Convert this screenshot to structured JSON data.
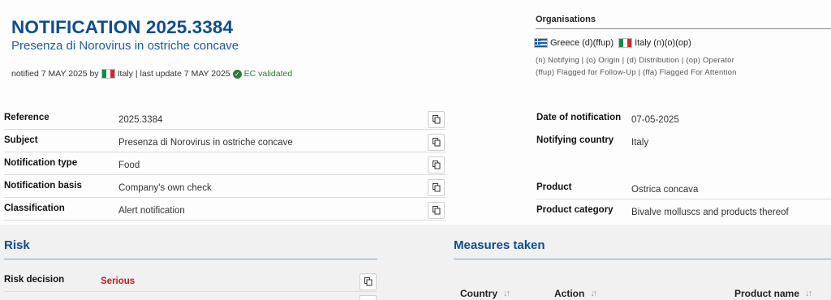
{
  "header": {
    "title": "NOTIFICATION 2025.3384",
    "subtitle": "Presenza di Norovirus in ostriche concave",
    "notified_prefix": "notified 7 MAY 2025 by",
    "notified_country": "Italy",
    "last_update": "| last update 7 MAY 2025",
    "ec_status": "EC validated"
  },
  "organisations": {
    "title": "Organisations",
    "countries": [
      {
        "name": "Greece (d)(ffup)",
        "flag": "greece-flag"
      },
      {
        "name": "Italy (n)(o)(op)",
        "flag": "italy-flag"
      }
    ],
    "legend_line1": "(n) Notifying | (o) Origin | (d) Distribution | (op) Operator",
    "legend_line2": "(ffup) Flagged for Follow-Up | (ffa) Flagged For Attention"
  },
  "details_left": [
    {
      "label": "Reference",
      "value": "2025.3384"
    },
    {
      "label": "Subject",
      "value": "Presenza di Norovirus in ostriche concave"
    },
    {
      "label": "Notification type",
      "value": "Food"
    },
    {
      "label": "Notification basis",
      "value": "Company's own check"
    },
    {
      "label": "Classification",
      "value": "Alert notification"
    }
  ],
  "details_right": {
    "date_label": "Date of notification",
    "date_value": "07-05-2025",
    "country_label": "Notifying country",
    "country_value": "Italy",
    "product_label": "Product",
    "product_value": "Ostrica concava",
    "category_label": "Product category",
    "category_value": "Bivalve molluscs and products thereof"
  },
  "risk": {
    "title": "Risk",
    "decision_label": "Risk decision",
    "decision_value": "Serious"
  },
  "measures": {
    "title": "Measures taken",
    "columns": [
      "Country",
      "Action",
      "Product name"
    ]
  },
  "colors": {
    "title_blue": "#0e4c92",
    "serious_red": "#c61d1d",
    "validated_green": "#2d7a33"
  }
}
